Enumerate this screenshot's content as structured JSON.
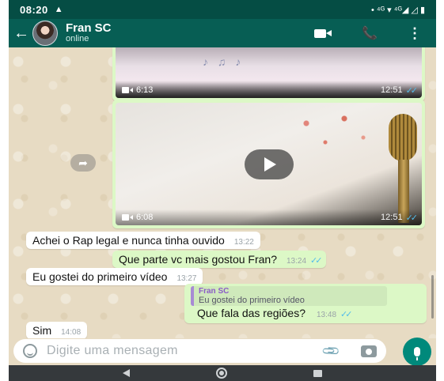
{
  "status_bar": {
    "time": "08:20",
    "left_icon": "warning-triangle-icon",
    "right_icons": [
      "dot",
      "4G wifi-icon",
      "4G signal-icon",
      "signal-icon",
      "battery-icon"
    ],
    "right_text": "• ⁴ᴳ ▾ ⁴ᴳ◢ ◿ ▮"
  },
  "header": {
    "contact_name": "Fran SC",
    "contact_status": "online",
    "icons": [
      "back-arrow-icon",
      "video-call-icon",
      "voice-call-icon",
      "more-options-icon"
    ]
  },
  "messages": {
    "video1": {
      "duration": "6:13",
      "time": "12:51",
      "ticks": "✓✓"
    },
    "video2": {
      "duration": "6:08",
      "time": "12:51",
      "ticks": "✓✓"
    },
    "m1": {
      "text": "Achei o Rap legal  e nunca tinha ouvido",
      "time": "13:22"
    },
    "m2": {
      "text": "Que parte vc mais gostou Fran?",
      "time": "13:24",
      "ticks": "✓✓"
    },
    "m3": {
      "text": "Eu gostei do primeiro vídeo",
      "time": "13:27"
    },
    "m4": {
      "quote_author": "Fran SC",
      "quote_text": "Eu gostei do primeiro vídeo",
      "text": "Que fala das regiões?",
      "time": "13:48",
      "ticks": "✓✓"
    },
    "m5": {
      "text": "Sim",
      "time": "14:08"
    }
  },
  "input": {
    "placeholder": "Digite uma mensagem",
    "icons": [
      "emoji-icon",
      "attach-icon",
      "camera-icon",
      "mic-icon"
    ]
  },
  "colors": {
    "header": "#075e54",
    "status_bar": "#054d44",
    "outgoing_bubble": "#dcf8c6",
    "incoming_bubble": "#ffffff",
    "read_ticks": "#53bdeb",
    "mic_button": "#00897b"
  }
}
